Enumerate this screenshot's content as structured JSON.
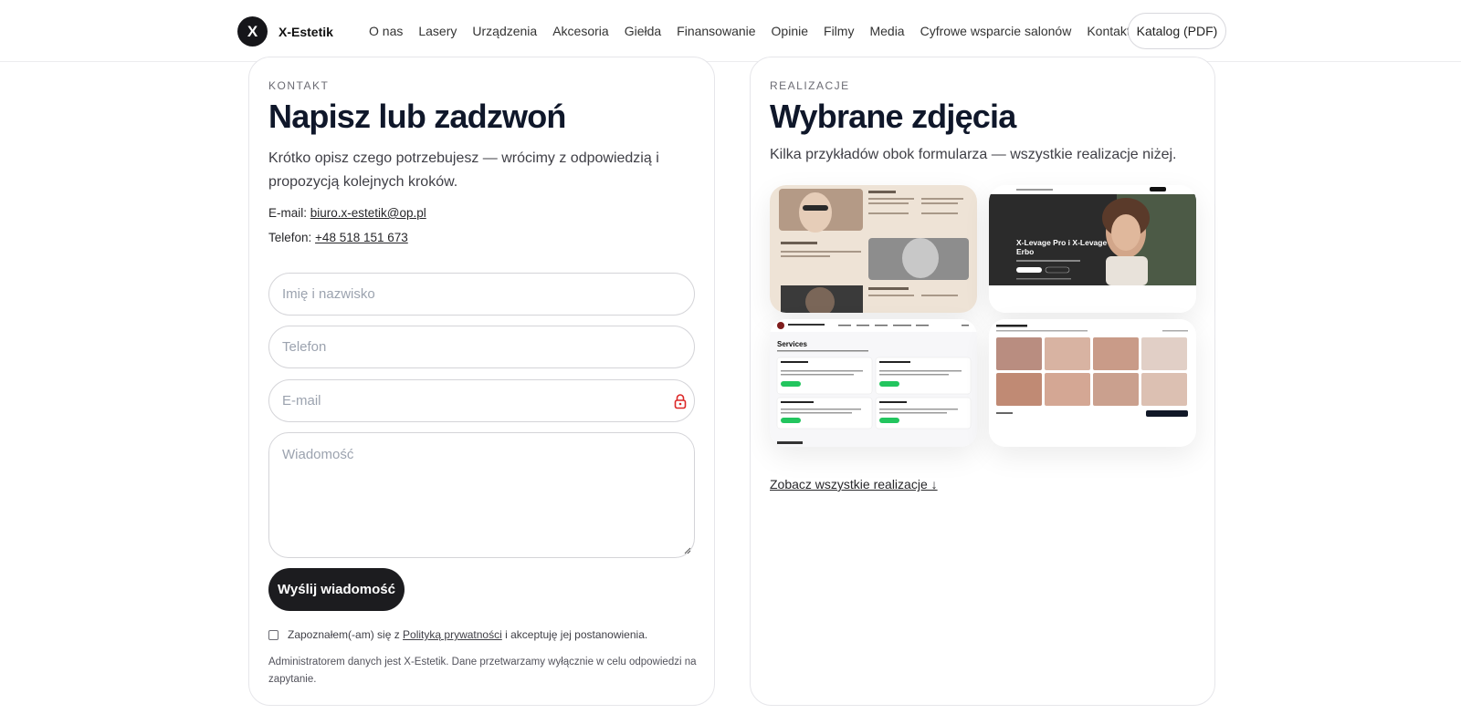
{
  "header": {
    "logo_letter": "X",
    "brand": "X-Estetik",
    "nav": [
      "O nas",
      "Lasery",
      "Urządzenia",
      "Akcesoria",
      "Giełda",
      "Finansowanie",
      "Opinie",
      "Filmy",
      "Media",
      "Cyfrowe wsparcie salonów",
      "Kontakt"
    ],
    "catalog_label": "Katalog (PDF)"
  },
  "contact": {
    "eyebrow": "KONTAKT",
    "title": "Napisz lub zadzwoń",
    "lead": "Krótko opisz czego potrzebujesz — wrócimy z odpowiedzią i propozycją kolejnych kroków.",
    "email_label": "E-mail: ",
    "email": "biuro.x-estetik@op.pl",
    "phone_label": "Telefon: ",
    "phone": "+48 518 151 673",
    "form": {
      "name_placeholder": "Imię i nazwisko",
      "phone_placeholder": "Telefon",
      "email_placeholder": "E-mail",
      "message_placeholder": "Wiadomość",
      "submit_label": "Wyślij wiadomość"
    },
    "consent_pre": "Zapoznałem(-am) się z ",
    "consent_link": "Polityką prywatności",
    "consent_post": " i akceptuję jej postanowienia.",
    "admin_note": "Administratorem danych jest X-Estetik. Dane przetwarzamy wyłącznie w celu odpowiedzi na zapytanie."
  },
  "gallery": {
    "eyebrow": "REALIZACJE",
    "title": "Wybrane zdjęcia",
    "description": "Kilka przykładów obok formularza — wszystkie realizacje niżej.",
    "thumb2_heading": "X-Levage Pro i X-Levage Erbo",
    "thumb3_heading": "Services",
    "see_all_label": "Zobacz wszystkie realizacje ↓"
  }
}
